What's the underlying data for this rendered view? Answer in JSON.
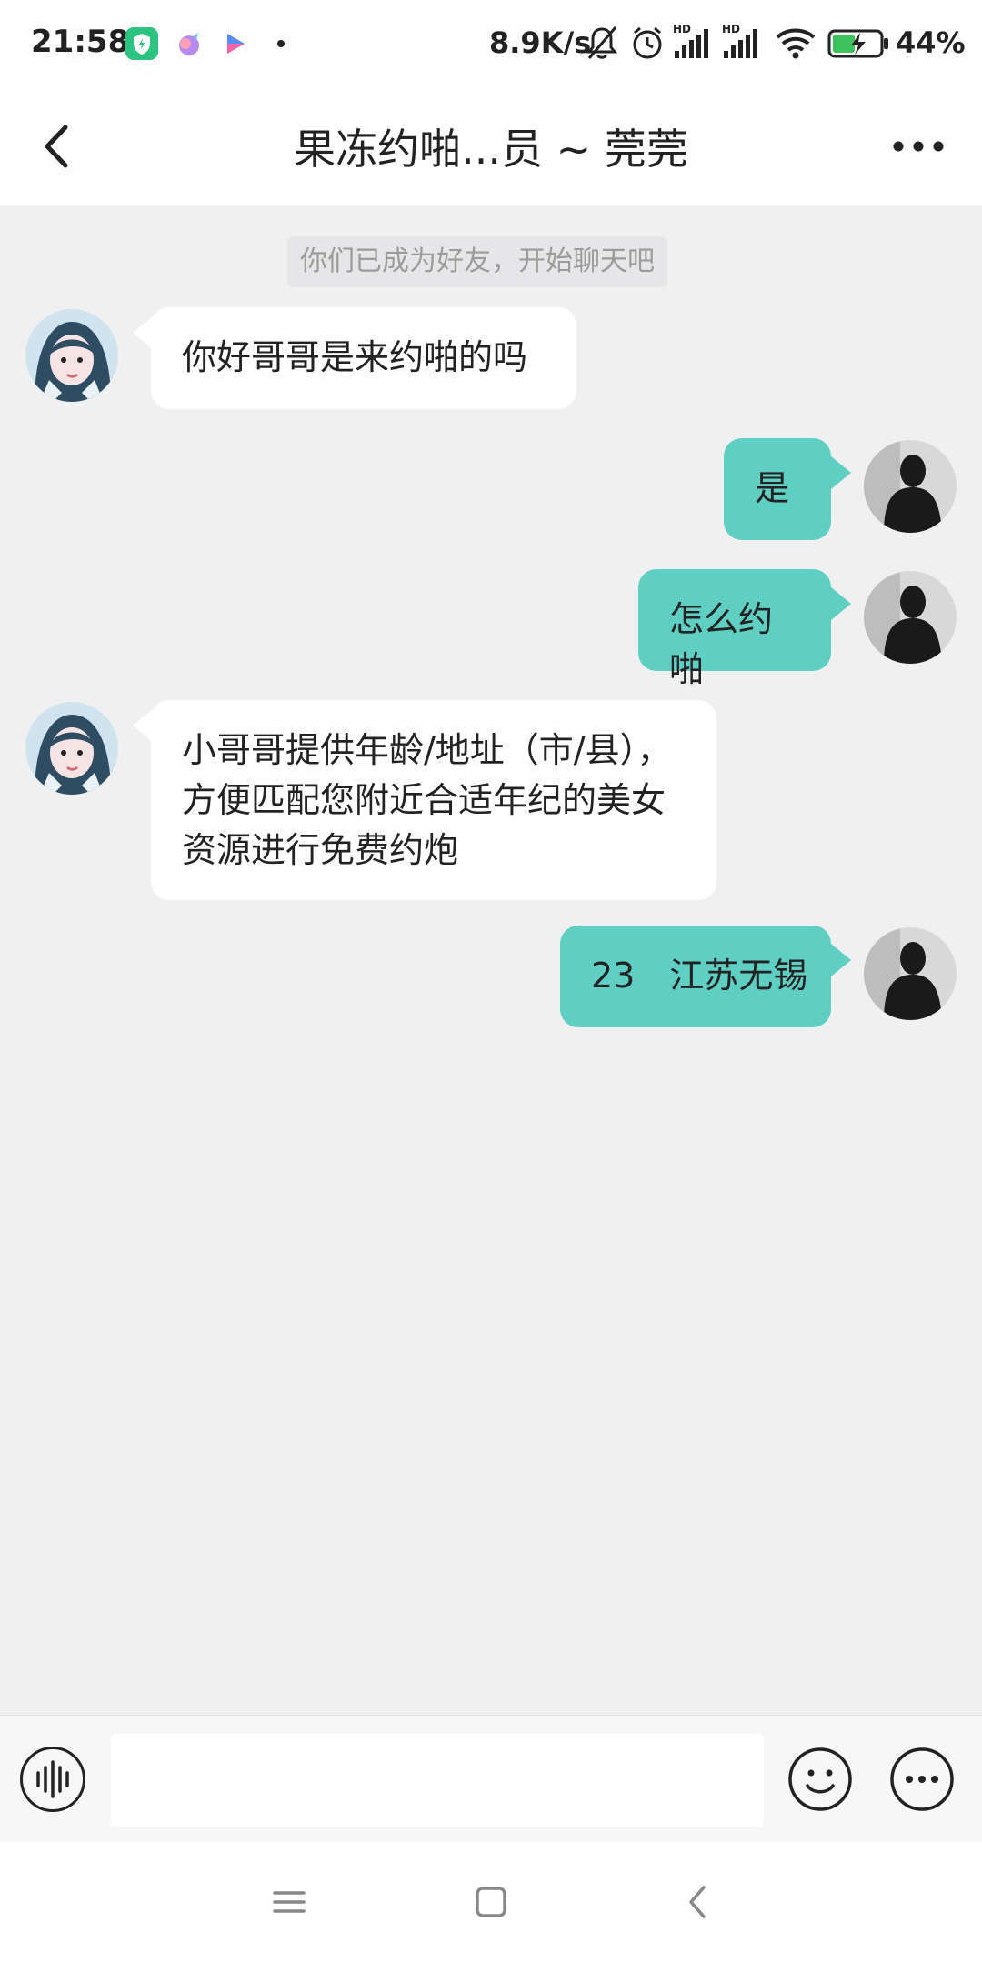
{
  "status_bar": {
    "time": "21:58",
    "net_speed": "8.9K/s",
    "battery_percent": "44%",
    "icons": [
      "shield-app-icon",
      "bird-app-icon",
      "video-app-icon",
      "dot-icon",
      "mute-bell-icon",
      "alarm-icon",
      "signal-hd-icon",
      "signal-hd-icon",
      "wifi-icon",
      "battery-charging-icon"
    ]
  },
  "header": {
    "title": "果冻约啪...员 ~ 莞莞",
    "back_icon": "chevron-left-icon",
    "more_icon": "more-dots-icon"
  },
  "chat": {
    "system_notice": "你们已成为好友，开始聊天吧",
    "messages": [
      {
        "side": "in",
        "text": "你好哥哥是来约啪的吗"
      },
      {
        "side": "out",
        "text": "是"
      },
      {
        "side": "out",
        "text": "怎么约啪"
      },
      {
        "side": "in",
        "text": "小哥哥提供年龄/地址（市/县），方便匹配您附近合适年纪的美女资源进行免费约炮"
      },
      {
        "side": "out",
        "text": "23　江苏无锡"
      }
    ]
  },
  "input_bar": {
    "placeholder": "",
    "value": "",
    "voice_icon": "voice-wave-icon",
    "emoji_icon": "smiley-icon",
    "more_icon": "more-circle-icon"
  },
  "nav_bar": {
    "icons": [
      "menu-lines-icon",
      "home-square-icon",
      "back-chevron-icon"
    ]
  },
  "colors": {
    "outgoing_bubble": "#5fcfc4",
    "incoming_bubble": "#ffffff",
    "chat_background": "#f0f0f1"
  }
}
